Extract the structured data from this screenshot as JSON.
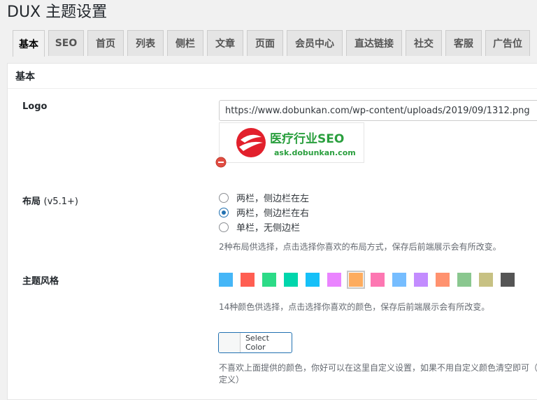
{
  "page": {
    "title": "DUX 主题设置"
  },
  "tabs": [
    {
      "label": "基本",
      "active": true
    },
    {
      "label": "SEO"
    },
    {
      "label": "首页"
    },
    {
      "label": "列表"
    },
    {
      "label": "侧栏"
    },
    {
      "label": "文章"
    },
    {
      "label": "页面"
    },
    {
      "label": "会员中心"
    },
    {
      "label": "直达链接"
    },
    {
      "label": "社交"
    },
    {
      "label": "客服"
    },
    {
      "label": "广告位"
    }
  ],
  "section": {
    "title": "基本"
  },
  "logo": {
    "label": "Logo",
    "value": "https://www.dobunkan.com/wp-content/uploads/2019/09/1312.png",
    "preview_title": "医疗行业SEO",
    "preview_url": "ask.dobunkan.com"
  },
  "layout": {
    "label": "布局",
    "version": "(v5.1+)",
    "options": [
      "两栏，侧边栏在左",
      "两栏，侧边栏在右",
      "单栏，无侧边栏"
    ],
    "selected_index": 1,
    "description": "2种布局供选择，点击选择你喜欢的布局方式，保存后前端展示会有所改变。"
  },
  "theme_style": {
    "label": "主题风格",
    "colors": [
      "#45b6f7",
      "#ff5e52",
      "#2cdb87",
      "#00d6ac",
      "#16c0f8",
      "#ea84ff",
      "#fdac5f",
      "#fd77b2",
      "#76bdff",
      "#c38cff",
      "#ff926f",
      "#8ac78f",
      "#c7c183",
      "#555555"
    ],
    "selected_index": 6,
    "description": "14种颜色供选择，点击选择你喜欢的颜色，保存后前端展示会有所改变。",
    "select_color_label": "Select Color",
    "custom_description_line1": "不喜欢上面提供的颜色，你好可以在这里自定义设置，如果不用自定义颜色清空即可（",
    "custom_description_line2": "定义）"
  }
}
